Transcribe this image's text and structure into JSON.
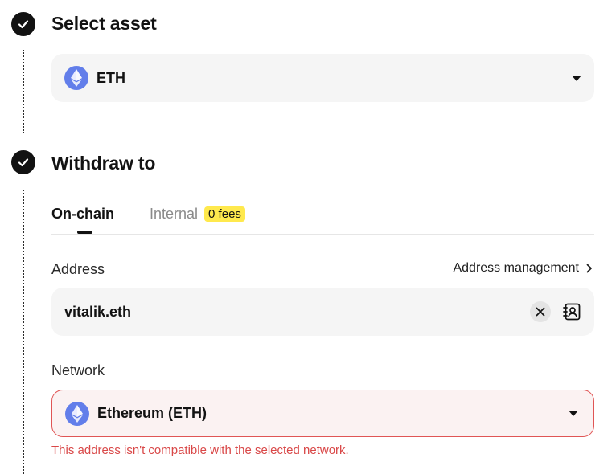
{
  "steps": {
    "select_asset": {
      "title": "Select asset",
      "selected_label": "ETH",
      "selected_icon": "ethereum-icon"
    },
    "withdraw_to": {
      "title": "Withdraw to"
    }
  },
  "tabs": {
    "onchain_label": "On-chain",
    "internal_label": "Internal",
    "internal_badge": "0 fees"
  },
  "address": {
    "label": "Address",
    "management_link": "Address management",
    "value": "vitalik.eth"
  },
  "network": {
    "label": "Network",
    "selected_label": "Ethereum (ETH)",
    "selected_icon": "ethereum-icon",
    "error": "This address isn't compatible with the selected network."
  },
  "colors": {
    "primary": "#121212",
    "field_background": "#f5f5f5",
    "ethereum": "#627eea",
    "badge": "#ffe94d",
    "error": "#d94848"
  }
}
